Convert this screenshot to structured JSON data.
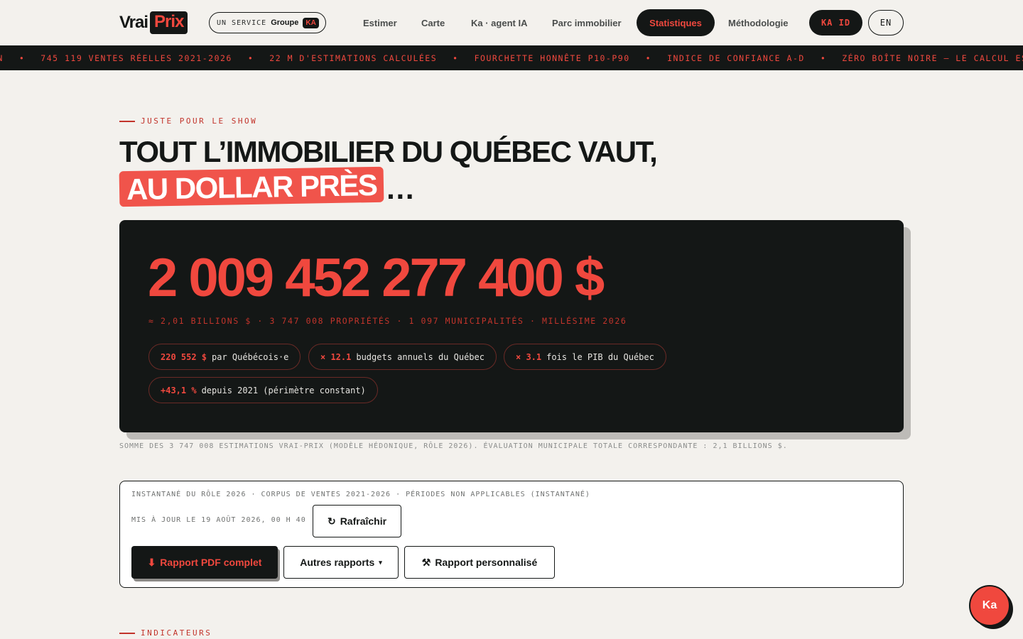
{
  "header": {
    "logo_vrai": "Vrai",
    "logo_prix": "Prix",
    "service_label": "UN SERVICE",
    "service_group": "Groupe",
    "service_badge": "KA",
    "nav": [
      {
        "label": "Estimer"
      },
      {
        "label": "Carte"
      },
      {
        "label": "Ka · agent IA"
      },
      {
        "label": "Parc immobilier"
      },
      {
        "label": "Statistiques",
        "active": true
      },
      {
        "label": "Méthodologie"
      }
    ],
    "kaid_label": "KA ID",
    "lang_label": "EN"
  },
  "ticker": {
    "items": [
      "ON",
      "745 119 VENTES RÉELLES 2021-2026",
      "22 M D'ESTIMATIONS CALCULÉES",
      "FOURCHETTE HONNÊTE P10-P90",
      "INDICE DE CONFIANCE A-D",
      "ZÉRO BOÎTE NOIRE — LE CALCUL EST MON"
    ],
    "separator": "•"
  },
  "hero": {
    "eyebrow": "JUSTE POUR LE SHOW",
    "title_line1": "TOUT L’IMMOBILIER DU QUÉBEC VAUT,",
    "title_highlight": "AU DOLLAR PRÈS",
    "title_ellipsis": "…"
  },
  "total_card": {
    "amount": "2 009 452 277 400 $",
    "subline": "≈ 2,01 BILLIONS $ · 3 747 008 PROPRIÉTÉS · 1 097 MUNICIPALITÉS · MILLÉSIME 2026",
    "chips": [
      {
        "value": "220 552 $",
        "text": "par Québécois·e"
      },
      {
        "value": "× 12.1",
        "text": "budgets annuels du Québec"
      },
      {
        "value": "× 3.1",
        "text": "fois le PIB du Québec"
      },
      {
        "value": "+43,1 %",
        "text": "depuis 2021 (périmètre constant)"
      }
    ]
  },
  "footnote": "SOMME DES 3 747 008 ESTIMATIONS VRAI-PRIX (MODÈLE HÉDONIQUE, RÔLE 2026). ÉVALUATION MUNICIPALE TOTALE CORRESPONDANTE : 2,1 BILLIONS $.",
  "info_box": {
    "meta": "INSTANTANÉ DU RÔLE 2026 · CORPUS DE VENTES 2021-2026 · PÉRIODES NON APPLICABLES (INSTANTANÉ)",
    "updated": "MIS À JOUR LE 19 AOÛT 2026, 00 H 40",
    "refresh_label": "Rafraîchir",
    "refresh_icon": "↻",
    "pdf_label": "Rapport PDF complet",
    "pdf_icon": "⬇",
    "other_label": "Autres rapports",
    "other_caret": "▾",
    "custom_label": "Rapport personnalisé",
    "custom_icon": "⚒"
  },
  "section2": {
    "eyebrow": "INDICATEURS"
  },
  "chat": {
    "label": "Ka"
  },
  "colors": {
    "accent": "#f0483e",
    "dark": "#141716",
    "background": "#f3f1ed"
  }
}
